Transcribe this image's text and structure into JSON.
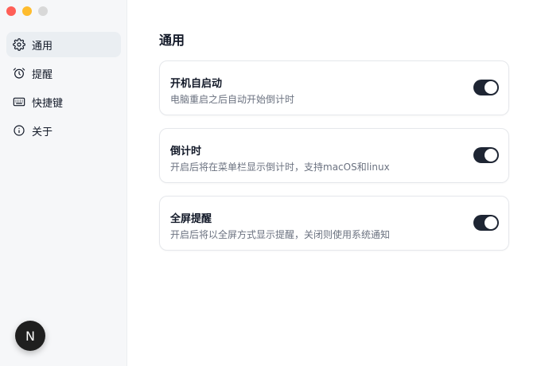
{
  "sidebar": {
    "items": [
      {
        "label": "通用",
        "icon": "gear-icon",
        "active": true
      },
      {
        "label": "提醒",
        "icon": "alarm-clock-icon",
        "active": false
      },
      {
        "label": "快捷键",
        "icon": "keyboard-icon",
        "active": false
      },
      {
        "label": "关于",
        "icon": "info-icon",
        "active": false
      }
    ],
    "avatar_letter": "N"
  },
  "main": {
    "title": "通用",
    "settings": [
      {
        "label": "开机自启动",
        "description": "电脑重启之后自动开始倒计时",
        "enabled": true
      },
      {
        "label": "倒计时",
        "description": "开启后将在菜单栏显示倒计时，支持macOS和linux",
        "enabled": true
      },
      {
        "label": "全屏提醒",
        "description": "开启后将以全屏方式显示提醒，关闭则使用系统通知",
        "enabled": true
      }
    ]
  },
  "colors": {
    "toggle_on": "#1e2533",
    "sidebar_bg": "#f6f7f9",
    "active_item_bg": "#eaeef2",
    "close": "#ff5f57",
    "minimize": "#febc2e",
    "maximize": "#d8d8d8"
  }
}
